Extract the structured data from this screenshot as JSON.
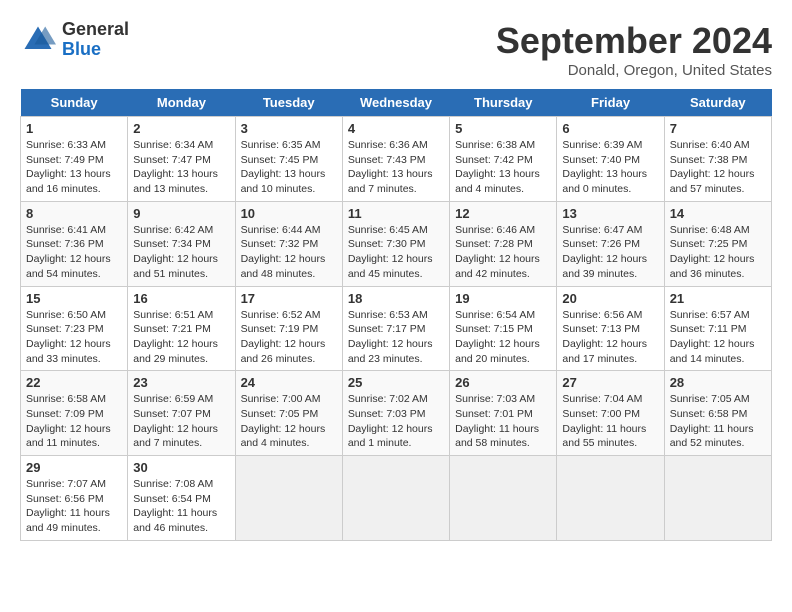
{
  "header": {
    "logo_general": "General",
    "logo_blue": "Blue",
    "month_title": "September 2024",
    "location": "Donald, Oregon, United States"
  },
  "weekdays": [
    "Sunday",
    "Monday",
    "Tuesday",
    "Wednesday",
    "Thursday",
    "Friday",
    "Saturday"
  ],
  "weeks": [
    [
      {
        "day": "1",
        "text": "Sunrise: 6:33 AM\nSunset: 7:49 PM\nDaylight: 13 hours\nand 16 minutes."
      },
      {
        "day": "2",
        "text": "Sunrise: 6:34 AM\nSunset: 7:47 PM\nDaylight: 13 hours\nand 13 minutes."
      },
      {
        "day": "3",
        "text": "Sunrise: 6:35 AM\nSunset: 7:45 PM\nDaylight: 13 hours\nand 10 minutes."
      },
      {
        "day": "4",
        "text": "Sunrise: 6:36 AM\nSunset: 7:43 PM\nDaylight: 13 hours\nand 7 minutes."
      },
      {
        "day": "5",
        "text": "Sunrise: 6:38 AM\nSunset: 7:42 PM\nDaylight: 13 hours\nand 4 minutes."
      },
      {
        "day": "6",
        "text": "Sunrise: 6:39 AM\nSunset: 7:40 PM\nDaylight: 13 hours\nand 0 minutes."
      },
      {
        "day": "7",
        "text": "Sunrise: 6:40 AM\nSunset: 7:38 PM\nDaylight: 12 hours\nand 57 minutes."
      }
    ],
    [
      {
        "day": "8",
        "text": "Sunrise: 6:41 AM\nSunset: 7:36 PM\nDaylight: 12 hours\nand 54 minutes."
      },
      {
        "day": "9",
        "text": "Sunrise: 6:42 AM\nSunset: 7:34 PM\nDaylight: 12 hours\nand 51 minutes."
      },
      {
        "day": "10",
        "text": "Sunrise: 6:44 AM\nSunset: 7:32 PM\nDaylight: 12 hours\nand 48 minutes."
      },
      {
        "day": "11",
        "text": "Sunrise: 6:45 AM\nSunset: 7:30 PM\nDaylight: 12 hours\nand 45 minutes."
      },
      {
        "day": "12",
        "text": "Sunrise: 6:46 AM\nSunset: 7:28 PM\nDaylight: 12 hours\nand 42 minutes."
      },
      {
        "day": "13",
        "text": "Sunrise: 6:47 AM\nSunset: 7:26 PM\nDaylight: 12 hours\nand 39 minutes."
      },
      {
        "day": "14",
        "text": "Sunrise: 6:48 AM\nSunset: 7:25 PM\nDaylight: 12 hours\nand 36 minutes."
      }
    ],
    [
      {
        "day": "15",
        "text": "Sunrise: 6:50 AM\nSunset: 7:23 PM\nDaylight: 12 hours\nand 33 minutes."
      },
      {
        "day": "16",
        "text": "Sunrise: 6:51 AM\nSunset: 7:21 PM\nDaylight: 12 hours\nand 29 minutes."
      },
      {
        "day": "17",
        "text": "Sunrise: 6:52 AM\nSunset: 7:19 PM\nDaylight: 12 hours\nand 26 minutes."
      },
      {
        "day": "18",
        "text": "Sunrise: 6:53 AM\nSunset: 7:17 PM\nDaylight: 12 hours\nand 23 minutes."
      },
      {
        "day": "19",
        "text": "Sunrise: 6:54 AM\nSunset: 7:15 PM\nDaylight: 12 hours\nand 20 minutes."
      },
      {
        "day": "20",
        "text": "Sunrise: 6:56 AM\nSunset: 7:13 PM\nDaylight: 12 hours\nand 17 minutes."
      },
      {
        "day": "21",
        "text": "Sunrise: 6:57 AM\nSunset: 7:11 PM\nDaylight: 12 hours\nand 14 minutes."
      }
    ],
    [
      {
        "day": "22",
        "text": "Sunrise: 6:58 AM\nSunset: 7:09 PM\nDaylight: 12 hours\nand 11 minutes."
      },
      {
        "day": "23",
        "text": "Sunrise: 6:59 AM\nSunset: 7:07 PM\nDaylight: 12 hours\nand 7 minutes."
      },
      {
        "day": "24",
        "text": "Sunrise: 7:00 AM\nSunset: 7:05 PM\nDaylight: 12 hours\nand 4 minutes."
      },
      {
        "day": "25",
        "text": "Sunrise: 7:02 AM\nSunset: 7:03 PM\nDaylight: 12 hours\nand 1 minute."
      },
      {
        "day": "26",
        "text": "Sunrise: 7:03 AM\nSunset: 7:01 PM\nDaylight: 11 hours\nand 58 minutes."
      },
      {
        "day": "27",
        "text": "Sunrise: 7:04 AM\nSunset: 7:00 PM\nDaylight: 11 hours\nand 55 minutes."
      },
      {
        "day": "28",
        "text": "Sunrise: 7:05 AM\nSunset: 6:58 PM\nDaylight: 11 hours\nand 52 minutes."
      }
    ],
    [
      {
        "day": "29",
        "text": "Sunrise: 7:07 AM\nSunset: 6:56 PM\nDaylight: 11 hours\nand 49 minutes."
      },
      {
        "day": "30",
        "text": "Sunrise: 7:08 AM\nSunset: 6:54 PM\nDaylight: 11 hours\nand 46 minutes."
      },
      {
        "day": "",
        "text": ""
      },
      {
        "day": "",
        "text": ""
      },
      {
        "day": "",
        "text": ""
      },
      {
        "day": "",
        "text": ""
      },
      {
        "day": "",
        "text": ""
      }
    ]
  ]
}
